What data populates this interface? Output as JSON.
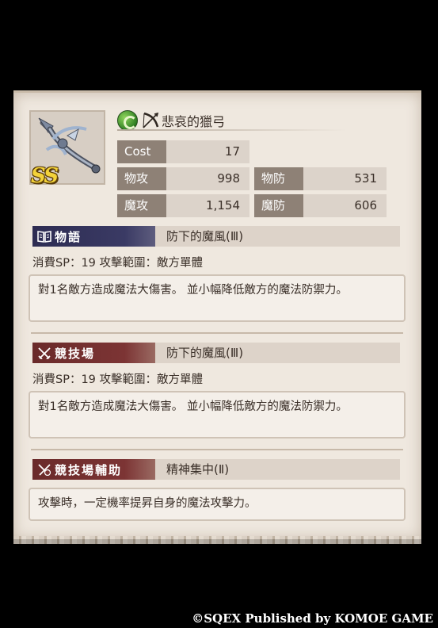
{
  "weapon": {
    "name": "悲哀的獵弓",
    "rank": "SS",
    "element_icon": "wind-element-icon",
    "type_icon": "bow-icon"
  },
  "stats": {
    "cost": {
      "label": "Cost",
      "value": "17"
    },
    "patk": {
      "label": "物攻",
      "value": "998"
    },
    "pdef": {
      "label": "物防",
      "value": "531"
    },
    "matk": {
      "label": "魔攻",
      "value": "1,154"
    },
    "mdef": {
      "label": "魔防",
      "value": "606"
    }
  },
  "story": {
    "badge": "物語",
    "skill": "防下的魔風(Ⅲ)",
    "meta": "消費SP：19 攻擊範圍：敵方單體",
    "desc": "對1名敵方造成魔法大傷害。 並小幅降低敵方的魔法防禦力。"
  },
  "arena": {
    "badge": "競技場",
    "skill": "防下的魔風(Ⅲ)",
    "meta": "消費SP：19 攻擊範圍：敵方單體",
    "desc": "對1名敵方造成魔法大傷害。 並小幅降低敵方的魔法防禦力。"
  },
  "arena_support": {
    "badge": "競技場輔助",
    "skill": "精神集中(Ⅱ)",
    "desc": "攻擊時，一定機率提昇自身的魔法攻擊力。"
  },
  "footer": {
    "copyright": "©SQEX Published by KOMOE GAME"
  },
  "colors": {
    "story_badge": "#2d2c52",
    "arena_badge": "#6a2a2a",
    "stat_label": "#8e8176",
    "card_bg": "#efe8df"
  }
}
